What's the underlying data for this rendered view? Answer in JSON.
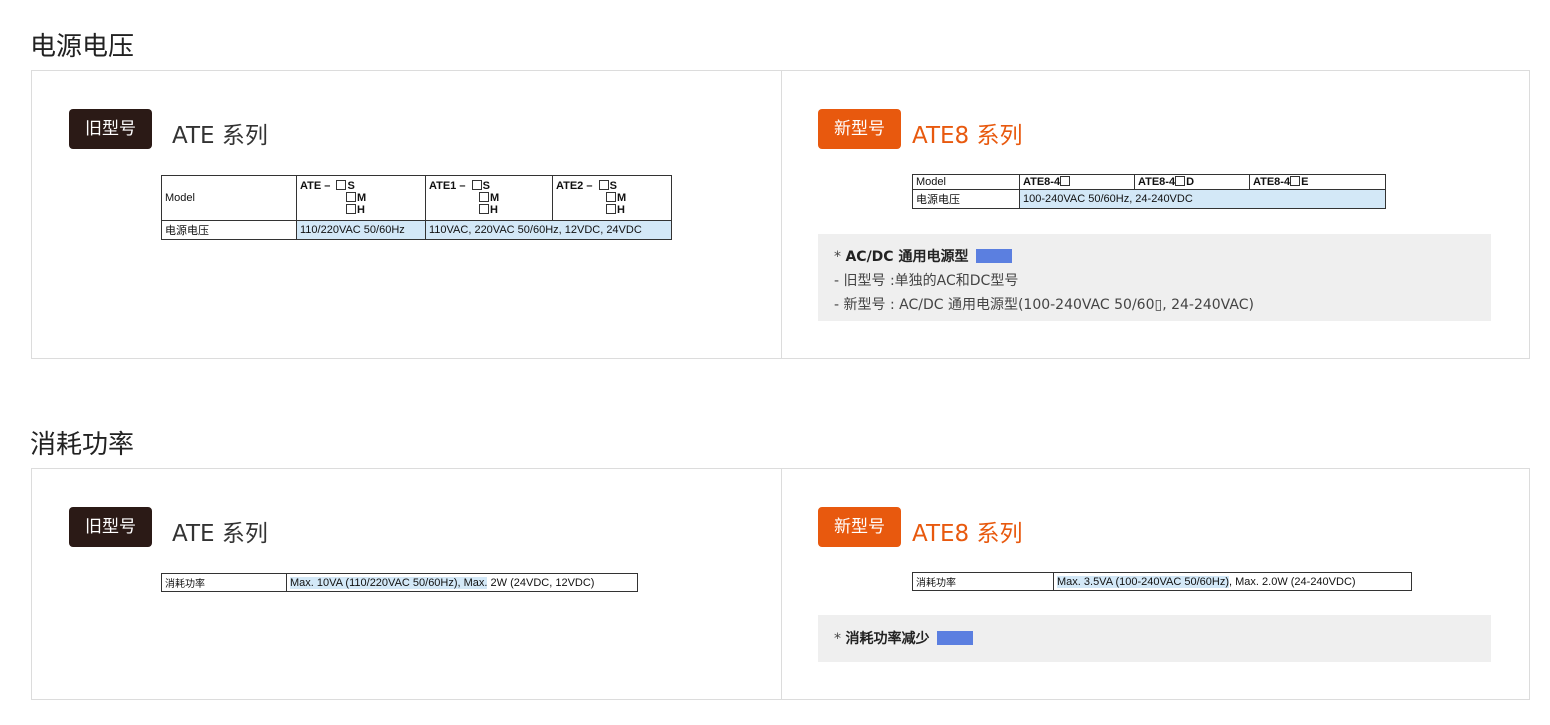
{
  "sections": [
    {
      "title": "电源电压",
      "old": {
        "badge": "旧型号",
        "series": "ATE 系列",
        "table": {
          "model_label": "Model",
          "columns": [
            {
              "prefix": "ATE –",
              "options": [
                "S",
                "M",
                "H"
              ]
            },
            {
              "prefix": "ATE1 –",
              "options": [
                "S",
                "M",
                "H"
              ]
            },
            {
              "prefix": "ATE2 –",
              "options": [
                "S",
                "M",
                "H"
              ]
            }
          ],
          "row_label": "电源电压",
          "values": [
            "110/220VAC 50/60Hz",
            "110VAC, 220VAC 50/60Hz, 12VDC, 24VDC"
          ]
        }
      },
      "new": {
        "badge": "新型号",
        "series": "ATE8 系列",
        "table": {
          "model_label": "Model",
          "columns": [
            "ATE8-4",
            "ATE8-4",
            "ATE8-4"
          ],
          "column_suffixes": [
            "",
            "D",
            "E"
          ],
          "row_label": "电源电压",
          "value": "100-240VAC 50/60Hz, 24-240VDC"
        },
        "note": {
          "bullet": "*",
          "head": "AC/DC 通用电源型",
          "lines": [
            "- 旧型号 :单独的AC和DC型号",
            "- 新型号 : AC/DC 通用电源型(100-240VAC 50/60▯, 24-240VAC)"
          ]
        }
      }
    },
    {
      "title": "消耗功率",
      "old": {
        "badge": "旧型号",
        "series": "ATE 系列",
        "table": {
          "row_label": "消耗功率",
          "value_hl": "Max. 10VA (110/220VAC 50/60Hz), Max.",
          "value_rest": " 2W (24VDC, 12VDC)"
        }
      },
      "new": {
        "badge": "新型号",
        "series": "ATE8 系列",
        "table": {
          "row_label": "消耗功率",
          "value_hl": "Max. 3.5VA (100-240VAC 50/60Hz)",
          "value_rest": ", Max. 2.0W (24-240VDC)"
        },
        "note": {
          "bullet": "*",
          "head": "消耗功率减少"
        }
      }
    }
  ],
  "colors": {
    "old_badge": "#2b1a16",
    "new_badge": "#e8590e",
    "highlight": "#d3e8f7",
    "swatch": "#5b7fe0"
  }
}
